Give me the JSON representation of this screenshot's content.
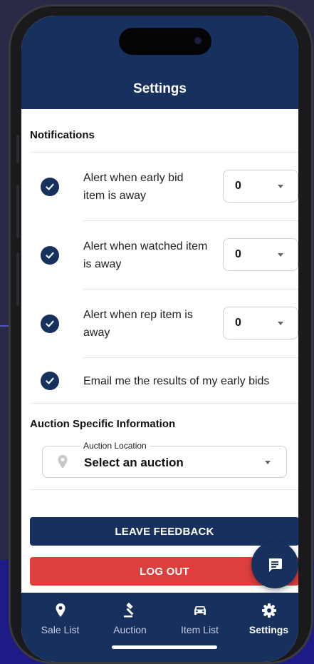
{
  "header": {
    "title": "Settings"
  },
  "notifications": {
    "section_title": "Notifications",
    "items": [
      {
        "label": "Alert when early bid item is away",
        "value": "0",
        "checked": true
      },
      {
        "label": "Alert when watched item is away",
        "value": "0",
        "checked": true
      },
      {
        "label": "Alert when rep item is away",
        "value": "0",
        "checked": true
      },
      {
        "label": "Email me the results of my early bids",
        "checked": true
      }
    ]
  },
  "auction_info": {
    "section_title": "Auction Specific Information",
    "location_label": "Auction Location",
    "location_value": "Select an auction"
  },
  "buttons": {
    "feedback": "LEAVE FEEDBACK",
    "logout": "LOG OUT"
  },
  "tabs": [
    {
      "label": "Sale List",
      "icon": "map-pin-icon",
      "active": false
    },
    {
      "label": "Auction",
      "icon": "gavel-icon",
      "active": false
    },
    {
      "label": "Item List",
      "icon": "car-icon",
      "active": false
    },
    {
      "label": "Settings",
      "icon": "gear-icon",
      "active": true
    }
  ],
  "colors": {
    "primary": "#17305e",
    "danger": "#dc3f3c",
    "background": "#ffffff"
  }
}
